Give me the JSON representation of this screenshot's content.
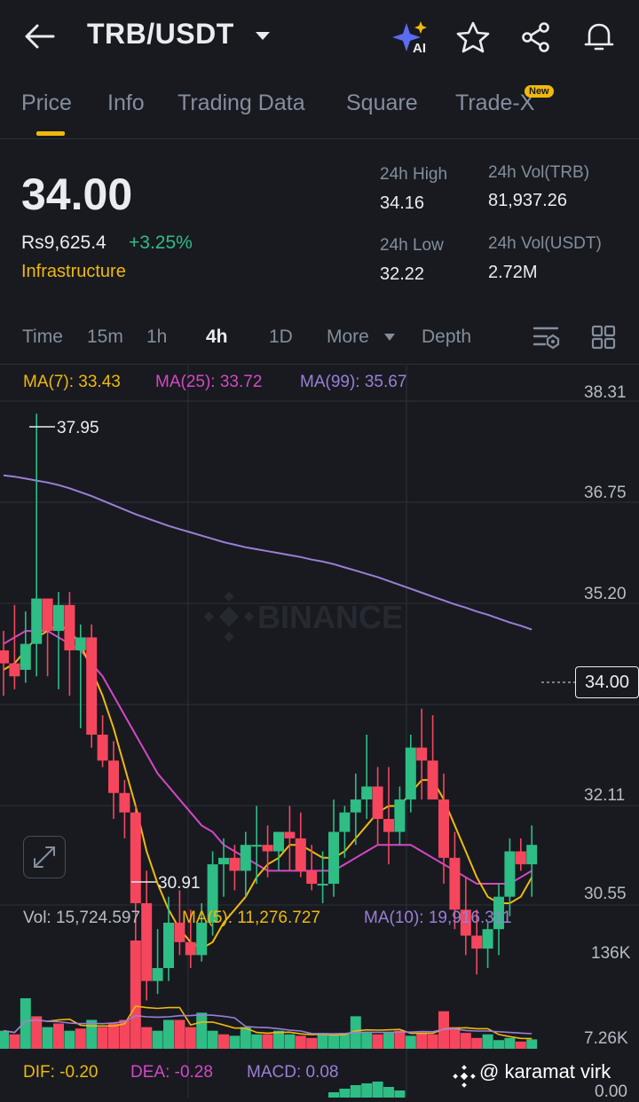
{
  "header": {
    "pair": "TRB/USDT",
    "icons": [
      "back-arrow-icon",
      "chevron-down-icon",
      "ai-sparkle-icon",
      "star-icon",
      "share-icon",
      "bell-icon"
    ]
  },
  "tabs": [
    {
      "label": "Price",
      "active": true
    },
    {
      "label": "Info",
      "active": false
    },
    {
      "label": "Trading Data",
      "active": false
    },
    {
      "label": "Square",
      "active": false
    },
    {
      "label": "Trade-X",
      "active": false,
      "badge": "New"
    }
  ],
  "ticker": {
    "last_price": "34.00",
    "fiat_price": "Rs9,625.4",
    "change": "+3.25%",
    "category": "Infrastructure",
    "stats": {
      "high_label": "24h High",
      "high_value": "34.16",
      "low_label": "24h Low",
      "low_value": "32.22",
      "vol_base_label": "24h Vol(TRB)",
      "vol_base_value": "81,937.26",
      "vol_quote_label": "24h Vol(USDT)",
      "vol_quote_value": "2.72M"
    }
  },
  "timeframes": {
    "items": [
      "Time",
      "15m",
      "1h",
      "4h",
      "1D",
      "More",
      "Depth"
    ],
    "selected": "4h"
  },
  "indicators": {
    "ma7": "MA(7): 33.43",
    "ma25": "MA(25): 33.72",
    "ma99": "MA(99): 35.67",
    "vol": "Vol: 15,724.597",
    "vol_ma5": "MA(5): 11,276.727",
    "vol_ma10": "MA(10): 19,916.311",
    "dif": "DIF: -0.20",
    "dea": "DEA: -0.28",
    "macd": "MACD: 0.08"
  },
  "colors": {
    "up": "#2ebd85",
    "down": "#f6465d",
    "accent": "#f0b90b",
    "ma7": "#f0b90b",
    "ma25": "#d448c6",
    "ma99": "#9b7fd6",
    "background": "#181a20"
  },
  "price_axis": [
    "38.31",
    "36.75",
    "35.20",
    "34.00",
    "32.11",
    "30.55"
  ],
  "volume_axis": [
    "136K",
    "7.26K"
  ],
  "macd_axis": [
    "0.00"
  ],
  "chart_markers": {
    "high": "37.95",
    "low": "30.91",
    "current": "34.00"
  },
  "watermark": "BINANCE",
  "credit": "@ karamat virk",
  "chart_data": {
    "type": "candlestick",
    "ylim": [
      30.55,
      38.31
    ],
    "candles": [
      [
        34.3,
        34.6,
        33.6,
        34.1
      ],
      [
        34.1,
        35.0,
        33.7,
        33.9
      ],
      [
        34.0,
        34.9,
        33.8,
        34.4
      ],
      [
        34.4,
        37.95,
        33.9,
        35.1
      ],
      [
        35.1,
        35.1,
        33.9,
        34.6
      ],
      [
        34.6,
        35.2,
        33.7,
        35.0
      ],
      [
        35.0,
        35.2,
        33.6,
        34.3
      ],
      [
        34.3,
        34.7,
        33.1,
        34.5
      ],
      [
        34.5,
        34.7,
        32.8,
        33.0
      ],
      [
        33.0,
        33.3,
        32.5,
        32.6
      ],
      [
        32.6,
        32.9,
        31.7,
        32.1
      ],
      [
        32.1,
        32.3,
        31.4,
        31.8
      ],
      [
        31.8,
        31.9,
        29.7,
        30.4
      ],
      [
        30.4,
        30.9,
        28.9,
        29.2
      ],
      [
        29.2,
        30.0,
        29.0,
        29.4
      ],
      [
        29.4,
        30.5,
        29.2,
        30.1
      ],
      [
        30.1,
        30.6,
        29.6,
        29.8
      ],
      [
        29.8,
        30.3,
        29.4,
        29.6
      ],
      [
        29.6,
        30.4,
        29.5,
        30.1
      ],
      [
        30.1,
        31.2,
        29.9,
        31.0
      ],
      [
        31.0,
        31.4,
        30.5,
        31.1
      ],
      [
        31.1,
        31.3,
        30.6,
        30.9
      ],
      [
        30.9,
        31.5,
        30.5,
        31.3
      ],
      [
        31.3,
        31.9,
        30.7,
        31.3
      ],
      [
        31.3,
        31.6,
        30.8,
        31.2
      ],
      [
        31.2,
        31.5,
        30.9,
        31.5
      ],
      [
        31.5,
        31.9,
        30.9,
        31.4
      ],
      [
        31.4,
        31.8,
        30.8,
        30.9
      ],
      [
        30.9,
        31.3,
        30.6,
        30.7
      ],
      [
        30.7,
        31.2,
        30.4,
        30.7
      ],
      [
        30.7,
        32.0,
        30.5,
        31.5
      ],
      [
        31.5,
        31.9,
        31.1,
        31.8
      ],
      [
        31.8,
        32.4,
        31.3,
        32.0
      ],
      [
        32.0,
        33.0,
        31.7,
        32.2
      ],
      [
        32.2,
        32.5,
        31.3,
        31.7
      ],
      [
        31.7,
        32.5,
        31.0,
        31.5
      ],
      [
        31.5,
        32.2,
        31.3,
        32.0
      ],
      [
        32.0,
        33.0,
        31.8,
        32.8
      ],
      [
        32.8,
        33.4,
        32.0,
        32.6
      ],
      [
        32.6,
        33.3,
        32.1,
        32.0
      ],
      [
        32.0,
        32.4,
        30.7,
        31.1
      ],
      [
        31.1,
        31.5,
        30.0,
        30.3
      ],
      [
        30.3,
        30.8,
        29.6,
        29.9
      ],
      [
        29.9,
        30.3,
        29.3,
        29.7
      ],
      [
        29.7,
        30.1,
        29.4,
        30.0
      ],
      [
        30.0,
        30.7,
        29.6,
        30.5
      ],
      [
        30.5,
        31.4,
        30.2,
        31.2
      ],
      [
        31.2,
        31.4,
        30.9,
        31.0
      ],
      [
        31.0,
        31.6,
        30.5,
        31.3
      ]
    ],
    "ma7": [
      34.0,
      34.1,
      34.3,
      34.5,
      34.6,
      34.7,
      34.6,
      34.4,
      34.0,
      33.6,
      33.1,
      32.5,
      31.9,
      31.2,
      30.7,
      30.3,
      30.0,
      29.8,
      29.7,
      29.8,
      30.1,
      30.3,
      30.5,
      30.8,
      31.0,
      31.1,
      31.3,
      31.3,
      31.2,
      31.1,
      31.1,
      31.2,
      31.4,
      31.6,
      31.8,
      31.9,
      31.9,
      32.1,
      32.3,
      32.3,
      32.0,
      31.6,
      31.2,
      30.8,
      30.5,
      30.4,
      30.4,
      30.5,
      30.8
    ],
    "ma25": [
      34.4,
      34.5,
      34.6,
      34.6,
      34.6,
      34.5,
      34.4,
      34.3,
      34.1,
      33.9,
      33.6,
      33.3,
      33.0,
      32.7,
      32.4,
      32.2,
      32.0,
      31.8,
      31.6,
      31.5,
      31.3,
      31.2,
      31.1,
      31.0,
      30.9,
      30.9,
      30.9,
      30.9,
      30.9,
      30.9,
      30.9,
      31.0,
      31.1,
      31.2,
      31.3,
      31.3,
      31.3,
      31.3,
      31.2,
      31.1,
      31.0,
      30.9,
      30.8,
      30.7,
      30.7,
      30.7,
      30.7,
      30.8,
      30.9
    ],
    "ma99": [
      37.0,
      36.98,
      36.95,
      36.92,
      36.89,
      36.85,
      36.8,
      36.74,
      36.68,
      36.61,
      36.54,
      36.47,
      36.4,
      36.34,
      36.28,
      36.22,
      36.17,
      36.12,
      36.07,
      36.02,
      35.97,
      35.93,
      35.89,
      35.86,
      35.83,
      35.8,
      35.77,
      35.74,
      35.7,
      35.67,
      35.63,
      35.58,
      35.53,
      35.48,
      35.43,
      35.37,
      35.31,
      35.25,
      35.19,
      35.13,
      35.07,
      35.01,
      34.96,
      34.9,
      34.85,
      34.79,
      34.73,
      34.68,
      34.62
    ],
    "volume": [
      {
        "v": 25,
        "up": true
      },
      {
        "v": 20,
        "up": false
      },
      {
        "v": 70,
        "up": true
      },
      {
        "v": 45,
        "up": false
      },
      {
        "v": 30,
        "up": true
      },
      {
        "v": 35,
        "up": false
      },
      {
        "v": 25,
        "up": true
      },
      {
        "v": 28,
        "up": false
      },
      {
        "v": 40,
        "up": true
      },
      {
        "v": 30,
        "up": false
      },
      {
        "v": 35,
        "up": false
      },
      {
        "v": 40,
        "up": false
      },
      {
        "v": 150,
        "up": false
      },
      {
        "v": 30,
        "up": false
      },
      {
        "v": 25,
        "up": true
      },
      {
        "v": 40,
        "up": true
      },
      {
        "v": 40,
        "up": false
      },
      {
        "v": 30,
        "up": false
      },
      {
        "v": 50,
        "up": true
      },
      {
        "v": 25,
        "up": true
      },
      {
        "v": 20,
        "up": false
      },
      {
        "v": 18,
        "up": true
      },
      {
        "v": 30,
        "up": true
      },
      {
        "v": 20,
        "up": true
      },
      {
        "v": 20,
        "up": false
      },
      {
        "v": 25,
        "up": true
      },
      {
        "v": 20,
        "up": true
      },
      {
        "v": 18,
        "up": false
      },
      {
        "v": 15,
        "up": false
      },
      {
        "v": 22,
        "up": true
      },
      {
        "v": 20,
        "up": true
      },
      {
        "v": 22,
        "up": true
      },
      {
        "v": 45,
        "up": true
      },
      {
        "v": 22,
        "up": true
      },
      {
        "v": 20,
        "up": false
      },
      {
        "v": 22,
        "up": true
      },
      {
        "v": 25,
        "up": false
      },
      {
        "v": 18,
        "up": true
      },
      {
        "v": 22,
        "up": false
      },
      {
        "v": 20,
        "up": false
      },
      {
        "v": 52,
        "up": false
      },
      {
        "v": 30,
        "up": false
      },
      {
        "v": 22,
        "up": false
      },
      {
        "v": 15,
        "up": false
      },
      {
        "v": 20,
        "up": true
      },
      {
        "v": 12,
        "up": true
      },
      {
        "v": 15,
        "up": true
      },
      {
        "v": 10,
        "up": false
      },
      {
        "v": 13,
        "up": true
      }
    ]
  }
}
